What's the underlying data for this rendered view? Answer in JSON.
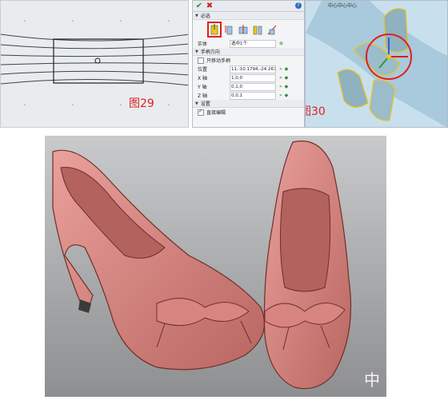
{
  "figure29": {
    "label": "图29"
  },
  "dialog": {
    "ok_icon": "check-icon",
    "cancel_icon": "close-icon",
    "help_icon": "help-icon",
    "section_required": "必选",
    "entity_label": "实体",
    "entity_value": "选中1个",
    "section_handle": "手柄方向",
    "only_move_handle": "只移动手柄",
    "position_label": "位置",
    "position_value": "11,-10.1794,-24.2672",
    "x_axis_label": "X 轴",
    "x_axis_value": "1,0,0",
    "y_axis_label": "Y 轴",
    "y_axis_value": "0,1,0",
    "z_axis_label": "Z 轴",
    "z_axis_value": "0,0,1",
    "section_settings": "设置",
    "direct_edit_label": "直接编辑"
  },
  "figure30": {
    "label": "图30",
    "viewport_title": "中心中心中心"
  },
  "render": {
    "watermark": "中"
  },
  "colors": {
    "shoe": "#d88581",
    "shoe_dark": "#8e3f3a",
    "highlight_red": "#e0201b",
    "gizmo_yellow": "#f0c619",
    "viewport_bg": "#c8e0ee",
    "render_bg": "#a8a9ab"
  }
}
